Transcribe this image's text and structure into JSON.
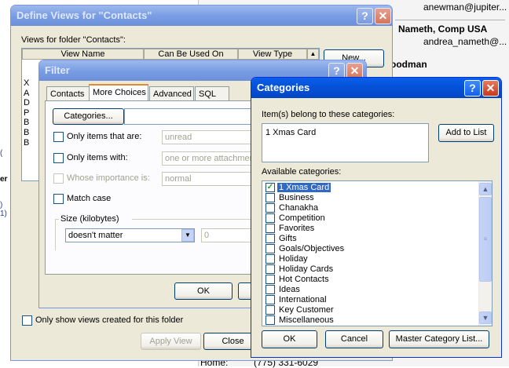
{
  "background": {
    "entries": [
      {
        "text": "anewman@jupiter...",
        "bold": false
      },
      {
        "text": "Nameth, Comp USA",
        "bold": true
      },
      {
        "text": "andrea_nameth@...",
        "bold": false
      },
      {
        "text": "oodman",
        "bold": true
      },
      {
        "text": "Home:",
        "bold": false
      },
      {
        "text": "(775) 331-6029",
        "bold": false
      }
    ]
  },
  "define_views": {
    "title": "Define Views for \"Contacts\"",
    "help": "?",
    "close": "✕",
    "views_label": "Views for folder \"Contacts\":",
    "columns": [
      "View Name",
      "Can Be Used On",
      "View Type"
    ],
    "row_initials": [
      "X",
      "A",
      "D",
      "P",
      "B",
      "B",
      "B"
    ],
    "new_button": "New...",
    "only_show_label": "Only show views created for this folder",
    "apply_view_button": "Apply View",
    "close_button": "Close"
  },
  "filter": {
    "title": "Filter",
    "help": "?",
    "close": "✕",
    "tabs": [
      "Contacts",
      "More Choices",
      "Advanced",
      "SQL"
    ],
    "categories_button": "Categories...",
    "only_items_that_are": "Only items that are:",
    "unread_value": "unread",
    "only_items_with": "Only items with:",
    "attachments_value": "one or more attachmen",
    "importance_label": "Whose importance is:",
    "importance_value": "normal",
    "match_case": "Match case",
    "size_group": "Size (kilobytes)",
    "size_value": "doesn't matter",
    "size_number": "0",
    "ok_button": "OK"
  },
  "categories": {
    "title": "Categories",
    "help": "?",
    "close": "✕",
    "belongs_label": "Item(s) belong to these categories:",
    "belongs_value": "1 Xmas Card",
    "add_to_list_button": "Add to List",
    "available_label": "Available categories:",
    "items": [
      {
        "label": "1 Xmas Card",
        "checked": true
      },
      {
        "label": "Business",
        "checked": false
      },
      {
        "label": "Chanakha",
        "checked": false
      },
      {
        "label": "Competition",
        "checked": false
      },
      {
        "label": "Favorites",
        "checked": false
      },
      {
        "label": "Gifts",
        "checked": false
      },
      {
        "label": "Goals/Objectives",
        "checked": false
      },
      {
        "label": "Holiday",
        "checked": false
      },
      {
        "label": "Holiday Cards",
        "checked": false
      },
      {
        "label": "Hot Contacts",
        "checked": false
      },
      {
        "label": "Ideas",
        "checked": false
      },
      {
        "label": "International",
        "checked": false
      },
      {
        "label": "Key Customer",
        "checked": false
      },
      {
        "label": "Miscellaneous",
        "checked": false
      }
    ],
    "ok_button": "OK",
    "cancel_button": "Cancel",
    "master_list_button": "Master Category List..."
  },
  "colors": {
    "accent": "#0553db",
    "selection": "#316ac5",
    "dialog_bg": "#ece9d8"
  }
}
